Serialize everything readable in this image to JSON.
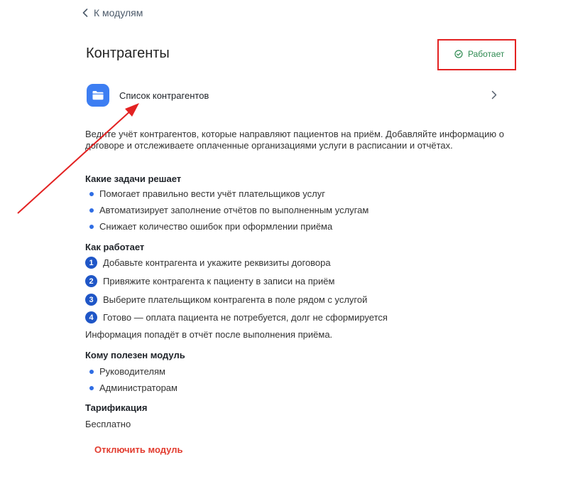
{
  "nav": {
    "back_label": "К модулям"
  },
  "header": {
    "title": "Контрагенты",
    "status_label": "Работает"
  },
  "list_link": {
    "label": "Список контрагентов"
  },
  "description": "Ведите учёт контрагентов, которые направляют пациентов на приём. Добавляйте информацию о договоре и отслеживаете оплаченные организациями услуги в расписании и отчётах.",
  "tasks": {
    "heading": "Какие задачи решает",
    "items": [
      "Помогает правильно вести учёт плательщиков услуг",
      "Автоматизирует заполнение отчётов по выполненным услугам",
      "Снижает количество ошибок при оформлении приёма"
    ]
  },
  "how": {
    "heading": "Как работает",
    "steps": [
      {
        "num": "1",
        "text": "Добавьте контрагента и укажите реквизиты договора"
      },
      {
        "num": "2",
        "text": "Привяжите контрагента к пациенту в записи на приём"
      },
      {
        "num": "3",
        "text": "Выберите плательщиком контрагента в поле рядом с услугой"
      },
      {
        "num": "4",
        "text": "Готово — оплата пациента не потребуется, долг не сформируется"
      }
    ],
    "note": "Информация попадёт в отчёт после выполнения приёма."
  },
  "audience": {
    "heading": "Кому полезен модуль",
    "items": [
      "Руководителям",
      "Администраторам"
    ]
  },
  "pricing": {
    "heading": "Тарификация",
    "value": "Бесплатно"
  },
  "actions": {
    "disable_label": "Отключить модуль"
  },
  "colors": {
    "accent": "#3d7ef2",
    "status_green": "#2e8a51",
    "danger": "#e23b2e",
    "annotation_red": "#e32222"
  },
  "icons": {
    "back": "chevron-left-icon",
    "status": "check-circle-icon",
    "list": "folder-icon",
    "open": "chevron-right-icon"
  }
}
